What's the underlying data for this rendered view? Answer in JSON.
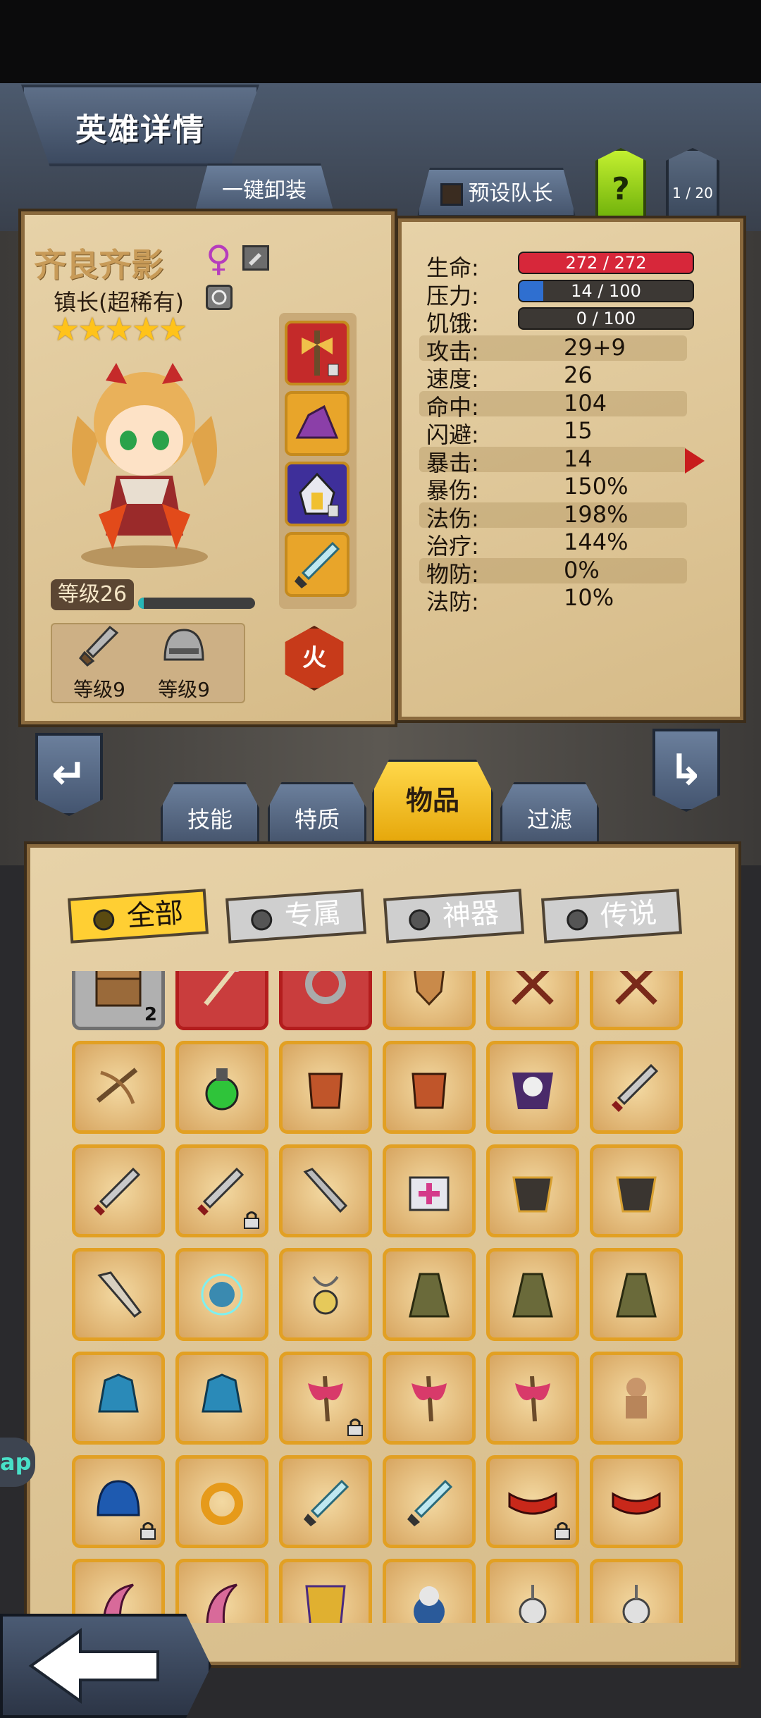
{
  "header": {
    "title": "英雄详情",
    "unequip_all": "一键卸装",
    "preset_captain": "预设队长",
    "help": "?",
    "page": "1 / 20"
  },
  "hero": {
    "name": "齐良齐影",
    "gender_icon": "female-icon",
    "title": "镇长(超稀有)",
    "stars": "★★★★★",
    "level_label": "等级26",
    "exp_progress": 0.05,
    "gear": [
      {
        "name": "sword-icon",
        "label": "等级9"
      },
      {
        "name": "helmet-icon",
        "label": "等级9"
      }
    ],
    "element": "火"
  },
  "stats": {
    "rows": [
      {
        "label": "生命:",
        "value": "272 / 272",
        "bar": 1.0,
        "bar_color": "#d7273a"
      },
      {
        "label": "压力:",
        "value": "14 / 100",
        "bar": 0.14,
        "bar_color": "#2f6fd0"
      },
      {
        "label": "饥饿:",
        "value": "0 / 100",
        "bar": 0.0,
        "bar_color": "#888888"
      },
      {
        "label": "攻击:",
        "value": "29+9"
      },
      {
        "label": "速度:",
        "value": "26"
      },
      {
        "label": "命中:",
        "value": "104"
      },
      {
        "label": "闪避:",
        "value": "15"
      },
      {
        "label": "暴击:",
        "value": "14"
      },
      {
        "label": "暴伤:",
        "value": "150%"
      },
      {
        "label": "法伤:",
        "value": "198%"
      },
      {
        "label": "治疗:",
        "value": "144%"
      },
      {
        "label": "物防:",
        "value": "0%"
      },
      {
        "label": "法防:",
        "value": "10%"
      }
    ]
  },
  "tabs": {
    "skills": "技能",
    "traits": "特质",
    "items": "物品",
    "filter": "过滤"
  },
  "filters": {
    "all": "全部",
    "exclusive": "专属",
    "artifact": "神器",
    "legend": "传说"
  },
  "items": [
    [
      {
        "icon": "chest-icon",
        "stack": "2",
        "style": "grey"
      },
      {
        "icon": "staff-icon",
        "style": "red"
      },
      {
        "icon": "ring-icon",
        "style": "red"
      },
      {
        "icon": "shield-icon"
      },
      {
        "icon": "crossed-swords-icon"
      },
      {
        "icon": "crossed-swords-icon"
      }
    ],
    [
      {
        "icon": "crossbow-icon"
      },
      {
        "icon": "potion-icon"
      },
      {
        "icon": "armor-icon"
      },
      {
        "icon": "armor-icon"
      },
      {
        "icon": "skull-cloak-icon"
      },
      {
        "icon": "blade-icon"
      }
    ],
    [
      {
        "icon": "blade-icon"
      },
      {
        "icon": "blade-icon",
        "locked": true
      },
      {
        "icon": "greatsword-icon"
      },
      {
        "icon": "medkit-icon"
      },
      {
        "icon": "dark-armor-icon"
      },
      {
        "icon": "dark-armor-icon"
      }
    ],
    [
      {
        "icon": "drill-lance-icon"
      },
      {
        "icon": "magic-orb-icon"
      },
      {
        "icon": "amulet-icon"
      },
      {
        "icon": "cloak-icon"
      },
      {
        "icon": "cloak-icon"
      },
      {
        "icon": "cloak-icon"
      }
    ],
    [
      {
        "icon": "crystal-helm-icon"
      },
      {
        "icon": "crystal-helm-icon"
      },
      {
        "icon": "heart-axe-icon",
        "locked": true
      },
      {
        "icon": "heart-axe-icon"
      },
      {
        "icon": "heart-axe-icon"
      },
      {
        "icon": "voodoo-doll-icon"
      }
    ],
    [
      {
        "icon": "blue-helmet-icon",
        "locked": true
      },
      {
        "icon": "gold-ring-icon"
      },
      {
        "icon": "crystal-sword-icon"
      },
      {
        "icon": "crystal-sword-icon"
      },
      {
        "icon": "red-belt-icon",
        "locked": true
      },
      {
        "icon": "red-belt-icon"
      }
    ],
    [
      {
        "icon": "claw-icon"
      },
      {
        "icon": "claw-icon"
      },
      {
        "icon": "gold-armor-icon"
      },
      {
        "icon": "beast-icon"
      },
      {
        "icon": "whistle-icon"
      },
      {
        "icon": "whistle-icon"
      }
    ]
  ],
  "side_badge": "ap"
}
